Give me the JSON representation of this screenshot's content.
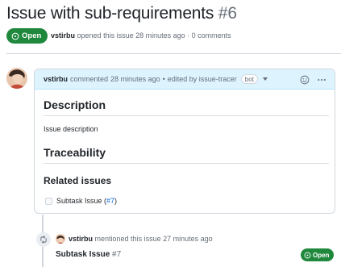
{
  "issue": {
    "title": "Issue with sub-requirements",
    "number": "#6",
    "state": "Open",
    "author": "vstirbu",
    "meta_text": "opened this issue 28 minutes ago · 0 comments"
  },
  "comment": {
    "author": "vstirbu",
    "action": "commented",
    "time": "28 minutes ago",
    "separator": "•",
    "edited_text": "edited by issue-tracer",
    "bot_label": "bot",
    "body": {
      "heading_description": "Description",
      "description_text": "Issue description",
      "heading_traceability": "Traceability",
      "heading_related": "Related issues",
      "task_text": "Subtask Issue (",
      "task_link": "#7",
      "task_close": ")"
    }
  },
  "event": {
    "actor": "vstirbu",
    "text": "mentioned this issue 27 minutes ago",
    "ref_title": "Subtask Issue",
    "ref_number": "#7",
    "ref_state": "Open"
  },
  "colors": {
    "open_green": "#1f883d",
    "link_blue": "#0969da",
    "header_blue": "#ddf4ff"
  },
  "icons": [
    "issue-opened-icon",
    "smiley-icon",
    "kebab-menu-icon",
    "cross-reference-icon"
  ]
}
